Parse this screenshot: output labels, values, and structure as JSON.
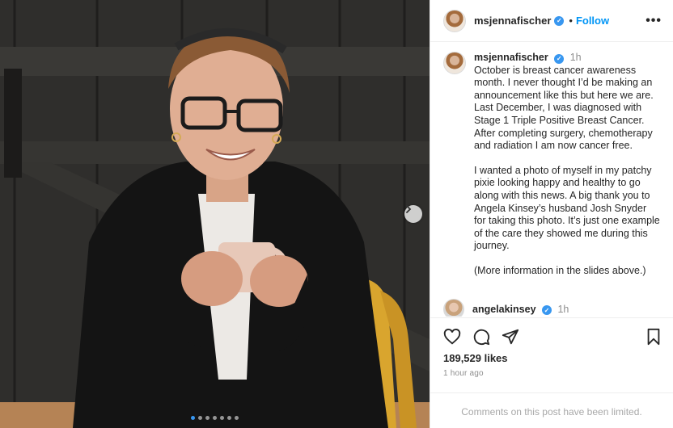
{
  "post": {
    "username": "msjennafischer",
    "verified_mark": "✓",
    "follow_label": "Follow",
    "separator": "•",
    "more_label": "•••"
  },
  "caption": {
    "username": "msjennafischer",
    "time": "1h",
    "paragraphs": [
      "October is breast cancer awareness month. I never thought I’d be making an announcement like this but here we are. Last December, I was diagnosed with Stage 1 Triple Positive Breast Cancer. After completing surgery, chemotherapy and radiation I am now cancer free.",
      "I wanted a photo of myself in my patchy pixie looking happy and healthy to go along with this news. A big thank you to Angela Kinsey’s husband Josh Snyder for taking this photo. It’s just one example of the care they showed me during this journey.",
      "(More information in the slides above.)"
    ]
  },
  "reply": {
    "username": "angelakinsey",
    "time": "1h"
  },
  "stats": {
    "likes": "189,529 likes",
    "posted_ago": "1 hour ago"
  },
  "comments_notice": "Comments on this post have been limited.",
  "carousel": {
    "slide_count": 7,
    "active_index": 0
  },
  "icons": [
    "heart-icon",
    "comment-icon",
    "share-icon",
    "bookmark-icon",
    "chevron-right-icon",
    "verified-badge-icon",
    "more-options-icon"
  ],
  "colors": {
    "accent": "#0095f6",
    "verified": "#3897f0",
    "muted": "#8e8e8e"
  }
}
